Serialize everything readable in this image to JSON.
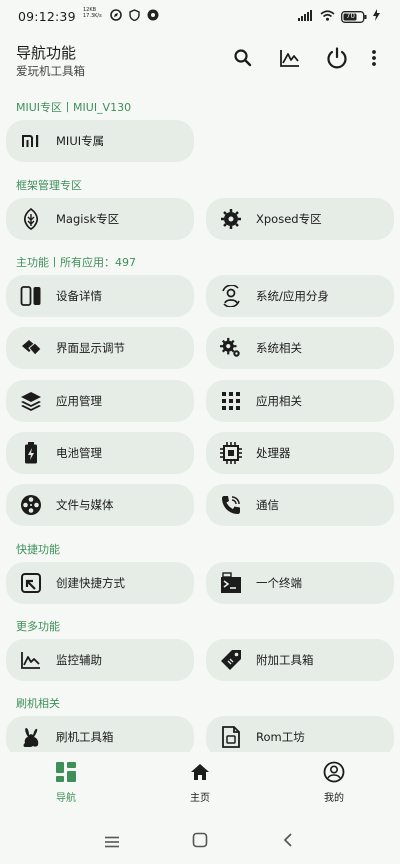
{
  "status": {
    "time": "09:12:39",
    "speed_value": "12KB",
    "speed_unit": "17.3K/s",
    "battery": "70"
  },
  "appbar": {
    "title": "导航功能",
    "subtitle": "爱玩机工具箱"
  },
  "sections": {
    "miui": "MIUI专区丨MIUI_V130",
    "framework": "框架管理专区",
    "main": "主功能丨所有应用：497",
    "shortcut": "快捷功能",
    "more": "更多功能",
    "flash": "刷机相关"
  },
  "items": {
    "miui_exclusive": "MIUI专属",
    "magisk": "Magisk专区",
    "xposed": "Xposed专区",
    "device_info": "设备详情",
    "app_clone": "系统/应用分身",
    "display_tuning": "界面显示调节",
    "system_related": "系统相关",
    "app_manage": "应用管理",
    "app_related": "应用相关",
    "battery_manage": "电池管理",
    "processor": "处理器",
    "files_media": "文件与媒体",
    "telecom": "通信",
    "create_shortcut": "创建快捷方式",
    "terminal": "一个终端",
    "monitor": "监控辅助",
    "extra_toolbox": "附加工具箱",
    "flash_toolbox": "刷机工具箱",
    "rom_workshop": "Rom工坊"
  },
  "nav": {
    "navigation": "导航",
    "home": "主页",
    "mine": "我的"
  },
  "colors": {
    "accent": "#3f8f5a",
    "card": "#e6ede6",
    "background": "#f6f8f6"
  }
}
